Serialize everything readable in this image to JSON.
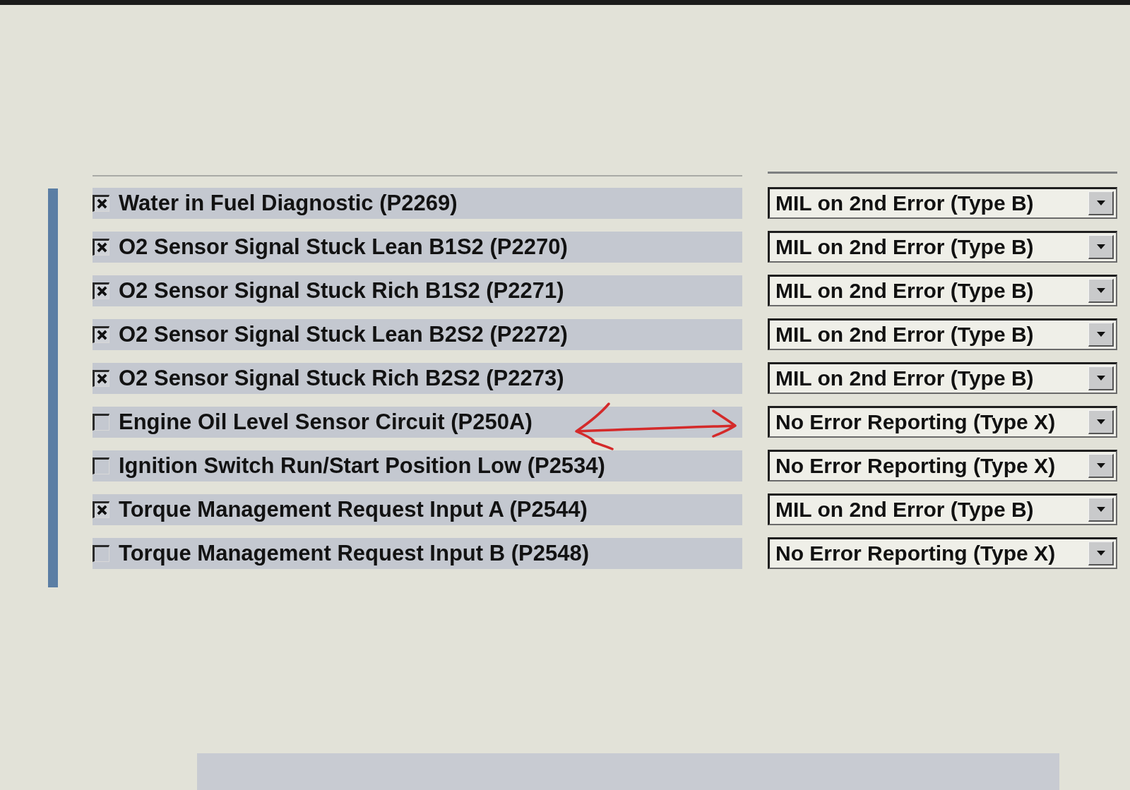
{
  "rows": [
    {
      "label": "Water in Fuel Diagnostic (P2269)",
      "checked": true,
      "setting": "MIL on 2nd Error (Type B)",
      "annotated": false
    },
    {
      "label": "O2 Sensor Signal Stuck Lean B1S2 (P2270)",
      "checked": true,
      "setting": "MIL on 2nd Error (Type B)",
      "annotated": false
    },
    {
      "label": "O2 Sensor Signal Stuck Rich B1S2 (P2271)",
      "checked": true,
      "setting": "MIL on 2nd Error (Type B)",
      "annotated": false
    },
    {
      "label": "O2 Sensor Signal Stuck Lean B2S2 (P2272)",
      "checked": true,
      "setting": "MIL on 2nd Error (Type B)",
      "annotated": false
    },
    {
      "label": "O2 Sensor Signal Stuck Rich B2S2 (P2273)",
      "checked": true,
      "setting": "MIL on 2nd Error (Type B)",
      "annotated": false
    },
    {
      "label": "Engine Oil Level Sensor Circuit (P250A)",
      "checked": false,
      "setting": "No Error Reporting (Type X)",
      "annotated": true
    },
    {
      "label": "Ignition Switch Run/Start Position Low (P2534)",
      "checked": false,
      "setting": "No Error Reporting (Type X)",
      "annotated": false
    },
    {
      "label": "Torque Management Request Input A (P2544)",
      "checked": true,
      "setting": "MIL on 2nd Error (Type B)",
      "annotated": false
    },
    {
      "label": "Torque Management Request Input B (P2548)",
      "checked": false,
      "setting": "No Error Reporting (Type X)",
      "annotated": false
    }
  ]
}
